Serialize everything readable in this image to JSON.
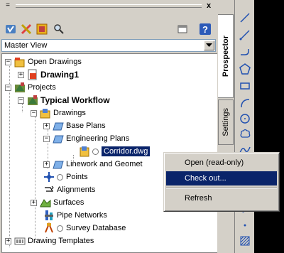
{
  "palette": {
    "minimize_glyph": "=",
    "close_glyph": "x",
    "master_view": "Master View",
    "tabs": {
      "prospector": "Prospector",
      "settings": "Settings"
    }
  },
  "tree": {
    "open_drawings": "Open Drawings",
    "drawing1": "Drawing1",
    "projects": "Projects",
    "typical_workflow": "Typical Workflow",
    "drawings": "Drawings",
    "base_plans": "Base Plans",
    "engineering_plans": "Engineering Plans",
    "corridor_dwg": "Corridor.dwg",
    "linework": "Linework and Geomet",
    "points": "Points",
    "alignments": "Alignments",
    "surfaces": "Surfaces",
    "pipe_networks": "Pipe Networks",
    "survey_database": "Survey Database",
    "drawing_templates": "Drawing Templates",
    "expand_plus": "+",
    "expand_minus": "−"
  },
  "context_menu": {
    "items": [
      "Open (read-only)",
      "Check out...",
      "Refresh"
    ],
    "highlighted": "Check out..."
  },
  "colors": {
    "selection": "#0a246a",
    "face": "#d4d0c8"
  }
}
